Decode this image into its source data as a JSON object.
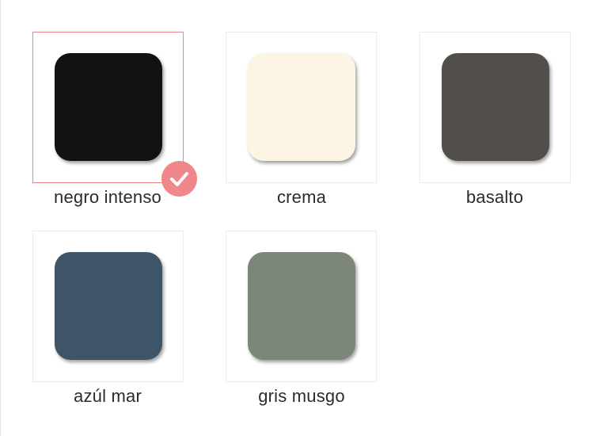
{
  "swatches": [
    {
      "label": "negro intenso",
      "color": "#121210",
      "selected": true
    },
    {
      "label": "crema",
      "color": "#fcf5e3",
      "selected": false
    },
    {
      "label": "basalto",
      "color": "#524f4a",
      "selected": false
    },
    {
      "label": "azúl mar",
      "color": "#3e5569",
      "selected": false
    },
    {
      "label": "gris musgo",
      "color": "#7c8679",
      "selected": false
    }
  ],
  "selection": {
    "badge_icon": "checkmark-icon",
    "badge_color": "#f0878a",
    "border_color": "#e8868b"
  }
}
